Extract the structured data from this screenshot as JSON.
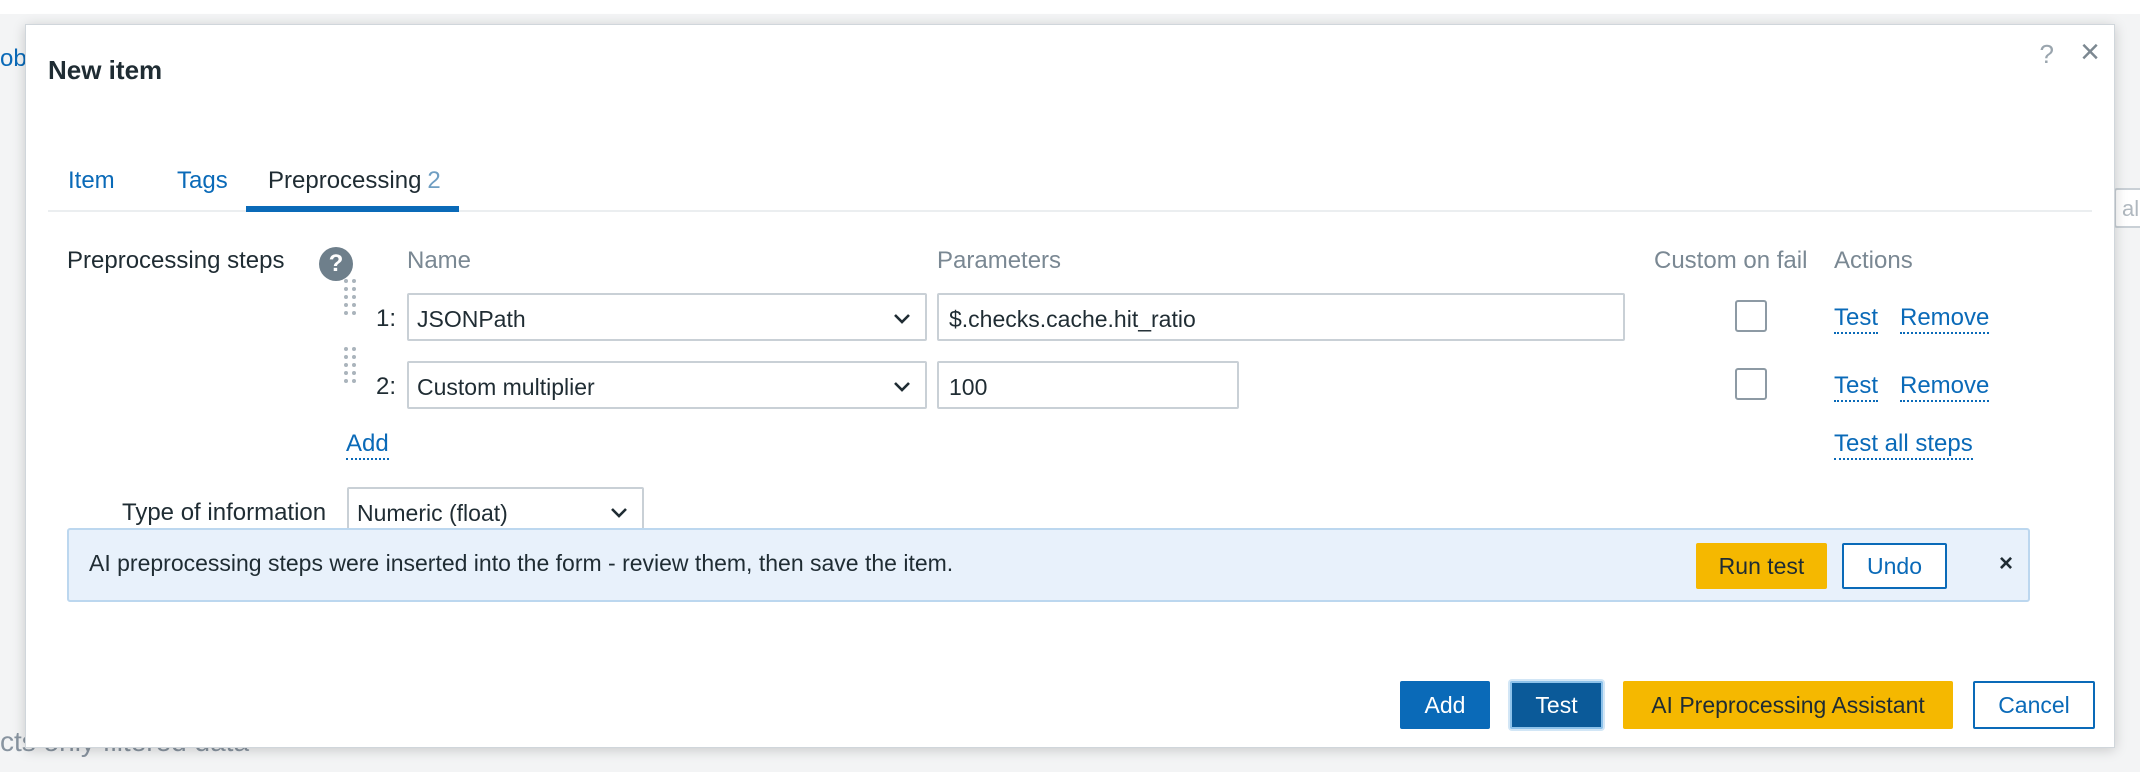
{
  "background": {
    "left_fragment": "obi",
    "right_fragment": "alu",
    "bottom_fragment": "cts only filtered data"
  },
  "dialog": {
    "title": "New item",
    "help_glyph": "?",
    "close_glyph": "×"
  },
  "tabs": [
    {
      "label": "Item"
    },
    {
      "label": "Tags"
    },
    {
      "label": "Preprocessing",
      "count": "2",
      "active": true
    }
  ],
  "preprocessing": {
    "label": "Preprocessing steps",
    "help_glyph": "?",
    "columns": {
      "name": "Name",
      "parameters": "Parameters",
      "custom_on_fail": "Custom on fail",
      "actions": "Actions"
    },
    "steps": [
      {
        "num": "1:",
        "name": "JSONPath",
        "parameter": "$.checks.cache.hit_ratio",
        "custom_on_fail": false,
        "test_label": "Test",
        "remove_label": "Remove"
      },
      {
        "num": "2:",
        "name": "Custom multiplier",
        "parameter": "100",
        "custom_on_fail": false,
        "test_label": "Test",
        "remove_label": "Remove"
      }
    ],
    "add_label": "Add",
    "test_all_label": "Test all steps"
  },
  "type_of_information": {
    "label": "Type of information",
    "value": "Numeric (float)"
  },
  "banner": {
    "text": "AI preprocessing steps were inserted into the form - review them, then save the item.",
    "run_test_label": "Run test",
    "undo_label": "Undo",
    "close_glyph": "×"
  },
  "footer": {
    "add_label": "Add",
    "test_label": "Test",
    "ai_label": "AI Preprocessing Assistant",
    "cancel_label": "Cancel"
  },
  "colors": {
    "link": "#0a6ab8",
    "primary_button": "#0a6ab8",
    "ai_button": "#f5b800",
    "banner_bg": "#e8f1fb"
  },
  "icons": {
    "select_arrow": "chevron-down-icon",
    "drag_handle": "drag-handle-icon"
  }
}
